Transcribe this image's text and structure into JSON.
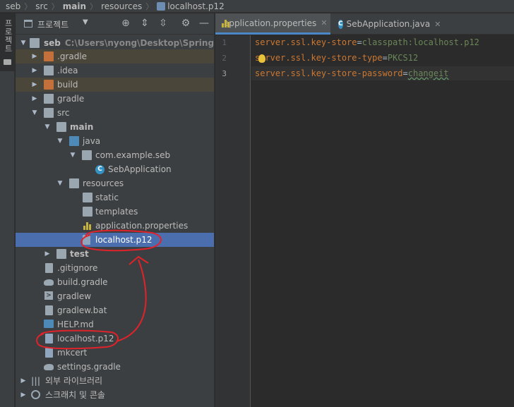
{
  "breadcrumb": {
    "items": [
      "seb",
      "src",
      "main",
      "resources",
      "localhost.p12"
    ]
  },
  "toolstrip": {
    "project_label": "프로젝트"
  },
  "project_panel": {
    "title": "프로젝트",
    "root_path": "C:\\Users\\nyong\\Desktop\\Spring\\sec",
    "tree": [
      {
        "label": "seb",
        "icon": "module-folder-icon",
        "arrow": "expanded"
      },
      {
        "label": ".gradle",
        "icon": "folder-icon",
        "arrow": "collapsed"
      },
      {
        "label": ".idea",
        "icon": "folder-icon",
        "arrow": "collapsed"
      },
      {
        "label": "build",
        "icon": "folder-icon",
        "arrow": "collapsed"
      },
      {
        "label": "gradle",
        "icon": "folder-icon",
        "arrow": "collapsed"
      },
      {
        "label": "src",
        "icon": "folder-icon",
        "arrow": "expanded"
      },
      {
        "label": "main",
        "icon": "folder-icon",
        "arrow": "expanded"
      },
      {
        "label": "java",
        "icon": "source-folder-icon",
        "arrow": "expanded"
      },
      {
        "label": "com.example.seb",
        "icon": "package-icon",
        "arrow": "expanded"
      },
      {
        "label": "SebApplication",
        "icon": "spring-class-icon",
        "arrow": "none"
      },
      {
        "label": "resources",
        "icon": "resources-folder-icon",
        "arrow": "expanded"
      },
      {
        "label": "static",
        "icon": "folder-icon",
        "arrow": "none"
      },
      {
        "label": "templates",
        "icon": "folder-icon",
        "arrow": "none"
      },
      {
        "label": "application.properties",
        "icon": "properties-file-icon",
        "arrow": "none"
      },
      {
        "label": "localhost.p12",
        "icon": "unknown-file-icon",
        "arrow": "none"
      },
      {
        "label": "test",
        "icon": "folder-icon",
        "arrow": "collapsed"
      },
      {
        "label": ".gitignore",
        "icon": "gitignore-file-icon",
        "arrow": "none"
      },
      {
        "label": "build.gradle",
        "icon": "gradle-file-icon",
        "arrow": "none"
      },
      {
        "label": "gradlew",
        "icon": "shell-file-icon",
        "arrow": "none"
      },
      {
        "label": "gradlew.bat",
        "icon": "bat-file-icon",
        "arrow": "none"
      },
      {
        "label": "HELP.md",
        "icon": "markdown-file-icon",
        "arrow": "none"
      },
      {
        "label": "localhost.p12",
        "icon": "unknown-file-icon",
        "arrow": "none"
      },
      {
        "label": "mkcert",
        "icon": "unknown-file-icon",
        "arrow": "none"
      },
      {
        "label": "settings.gradle",
        "icon": "gradle-file-icon",
        "arrow": "none"
      },
      {
        "label": "외부 라이브러리",
        "icon": "libraries-icon",
        "arrow": "collapsed"
      },
      {
        "label": "스크래치 및 콘솔",
        "icon": "scratches-icon",
        "arrow": "collapsed"
      }
    ]
  },
  "editor": {
    "tabs": [
      {
        "label": "application.properties",
        "active": true
      },
      {
        "label": "SebApplication.java",
        "active": false
      }
    ],
    "lines": [
      {
        "number": "1",
        "key": "server.ssl.key-store",
        "value": "classpath:localhost.p12"
      },
      {
        "number": "2",
        "key": "server.ssl.key-store-type",
        "value": "PKCS12"
      },
      {
        "number": "3",
        "key": "server.ssl.key-store-password",
        "value": "changeit"
      }
    ]
  },
  "colors": {
    "selection": "#4b6eaf",
    "annotation": "#e0232b",
    "key": "#cc7832",
    "value": "#6a8759"
  }
}
